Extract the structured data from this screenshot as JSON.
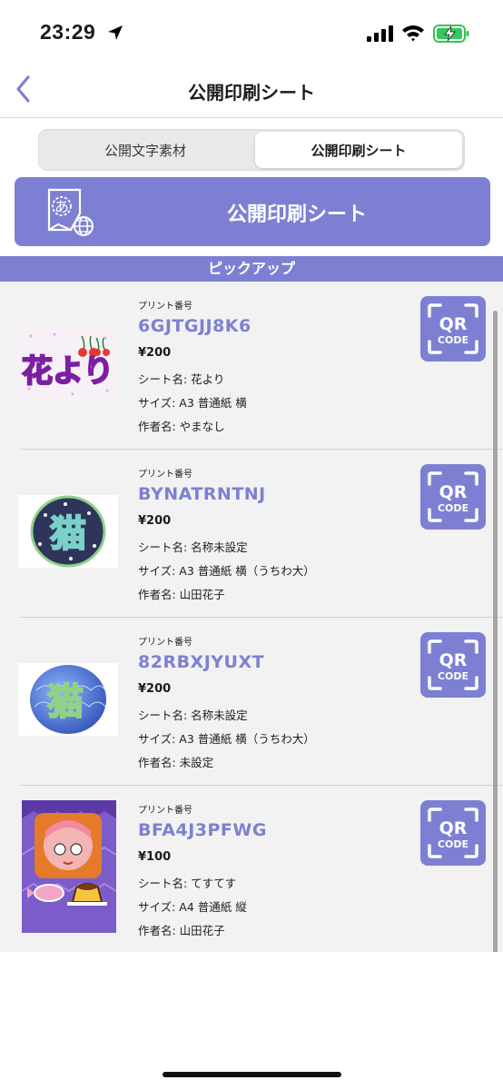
{
  "status_bar": {
    "time": "23:29"
  },
  "nav": {
    "title": "公開印刷シート"
  },
  "segments": [
    {
      "label": "公開文字素材",
      "selected": false
    },
    {
      "label": "公開印刷シート",
      "selected": true
    }
  ],
  "banner": {
    "title": "公開印刷シート",
    "icon_glyph": "あ"
  },
  "pickup": {
    "label": "ピックアップ"
  },
  "items": [
    {
      "print_label": "プリント番号",
      "code": "6GJTGJJ8K6",
      "price": "¥200",
      "sheet_name": "シート名: 花より",
      "size": "サイズ: A3 普通紙 横",
      "author": "作者名: やまなし",
      "thumb_text": "花より",
      "qr_line1": "QR",
      "qr_line2": "CODE"
    },
    {
      "print_label": "プリント番号",
      "code": "BYNATRNTNJ",
      "price": "¥200",
      "sheet_name": "シート名: 名称未設定",
      "size": "サイズ: A3 普通紙 横（うちわ大）",
      "author": "作者名: 山田花子",
      "thumb_text": "猫",
      "qr_line1": "QR",
      "qr_line2": "CODE"
    },
    {
      "print_label": "プリント番号",
      "code": "82RBXJYUXT",
      "price": "¥200",
      "sheet_name": "シート名: 名称未設定",
      "size": "サイズ: A3 普通紙 横（うちわ大）",
      "author": "作者名: 未設定",
      "thumb_text": "猫",
      "qr_line1": "QR",
      "qr_line2": "CODE"
    },
    {
      "print_label": "プリント番号",
      "code": "BFA4J3PFWG",
      "price": "¥100",
      "sheet_name": "シート名: てすてす",
      "size": "サイズ: A4 普通紙 縦",
      "author": "作者名: 山田花子",
      "qr_line1": "QR",
      "qr_line2": "CODE"
    }
  ],
  "colors": {
    "accent": "#7d80d2",
    "list_bg": "#f2f2f2",
    "battery": "#34c759"
  }
}
